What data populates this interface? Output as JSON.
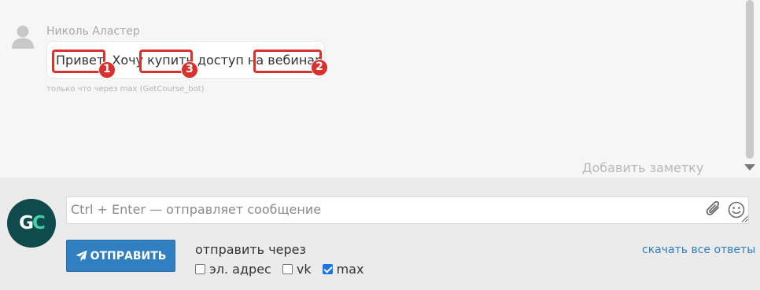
{
  "message": {
    "author": "Николь Аластер",
    "text": "Привет. Хочу купить доступ на вебинар",
    "meta": "только что через max (GetCourse_bot)"
  },
  "annotations": [
    {
      "label": "1",
      "word": "Привет"
    },
    {
      "label": "3",
      "word": "купить"
    },
    {
      "label": "2",
      "word": "вебинар"
    }
  ],
  "add_note": "Добавить заметку",
  "composer": {
    "logo_text_g": "G",
    "logo_text_c": "C",
    "placeholder": "Ctrl + Enter — отправляет сообщение",
    "send_label": "ОТПРАВИТЬ",
    "send_via_label": "отправить через",
    "channels": [
      {
        "label": "эл. адрес",
        "checked": false
      },
      {
        "label": "vk",
        "checked": false
      },
      {
        "label": "max",
        "checked": true
      }
    ],
    "download_label": "скачать все ответы"
  },
  "colors": {
    "accent": "#2f7fc1",
    "highlight": "#d9312b",
    "logo_bg": "#0f4a4c",
    "logo_c": "#3fd3a6"
  }
}
